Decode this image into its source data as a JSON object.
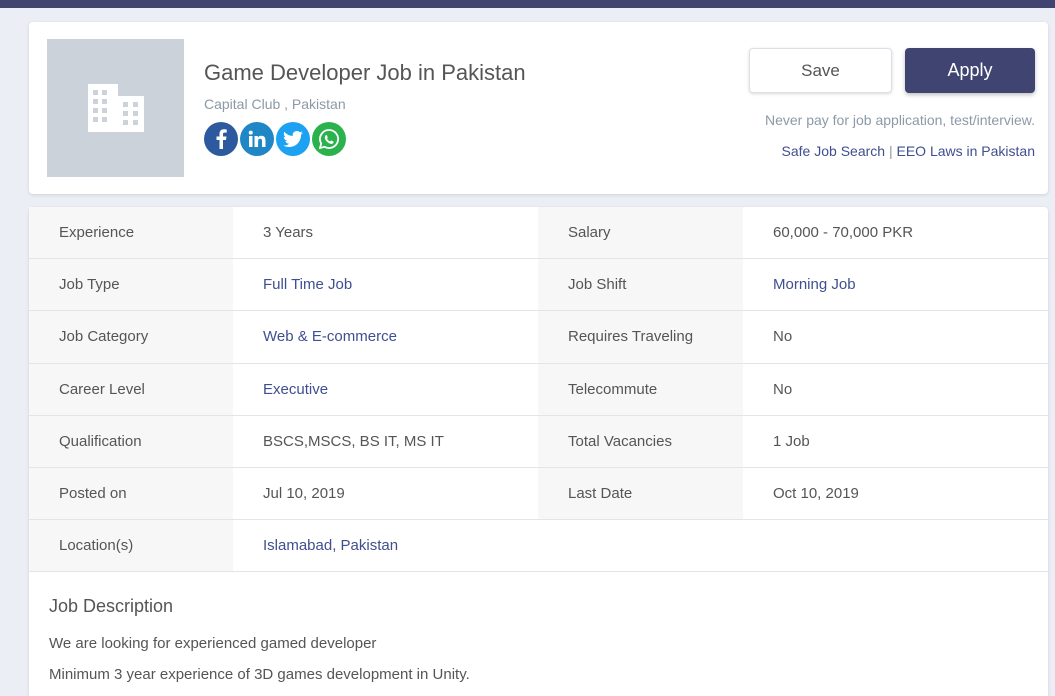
{
  "job": {
    "title": "Game Developer Job in Pakistan",
    "company": "Capital Club , Pakistan",
    "save_label": "Save",
    "apply_label": "Apply",
    "warning": "Never pay for job application, test/interview.",
    "safe_search_link": "Safe Job Search",
    "separator": "|",
    "eeo_link": "EEO Laws in Pakistan",
    "socials": [
      {
        "icon": "facebook-icon",
        "glyph": "f",
        "color": "#2d5a9e"
      },
      {
        "icon": "linkedin-icon",
        "glyph": "in",
        "color": "#1f87c5"
      },
      {
        "icon": "twitter-icon",
        "glyph": "t",
        "color": "#1da1f2"
      },
      {
        "icon": "whatsapp-icon",
        "glyph": "w",
        "color": "#2bb24c"
      }
    ]
  },
  "details": {
    "rows": [
      {
        "l1": "Experience",
        "v1": "3 Years",
        "l2": "Salary",
        "v2": "60,000 - 70,000 PKR"
      },
      {
        "l1": "Job Type",
        "v1": "Full Time Job",
        "l2": "Job Shift",
        "v2": "Morning Job"
      },
      {
        "l1": "Job Category",
        "v1": "Web & E-commerce",
        "l2": "Requires Traveling",
        "v2": "No"
      },
      {
        "l1": "Career Level",
        "v1": "Executive",
        "l2": "Telecommute",
        "v2": "No"
      },
      {
        "l1": "Qualification",
        "v1": "BSCS,MSCS, BS IT, MS IT",
        "l2": "Total Vacancies",
        "v2": "1 Job"
      },
      {
        "l1": "Posted on",
        "v1": "Jul 10, 2019",
        "l2": "Last Date",
        "v2": "Oct 10, 2019"
      },
      {
        "l1": "Location(s)",
        "v1": "Islamabad, Pakistan"
      }
    ]
  },
  "description": {
    "title": "Job Description",
    "lines": [
      "We are looking for experienced gamed developer",
      "Minimum 3 year experience of 3D games development in Unity."
    ]
  },
  "colors": {
    "brand": "#3f4470",
    "link": "#3f4f8f"
  }
}
